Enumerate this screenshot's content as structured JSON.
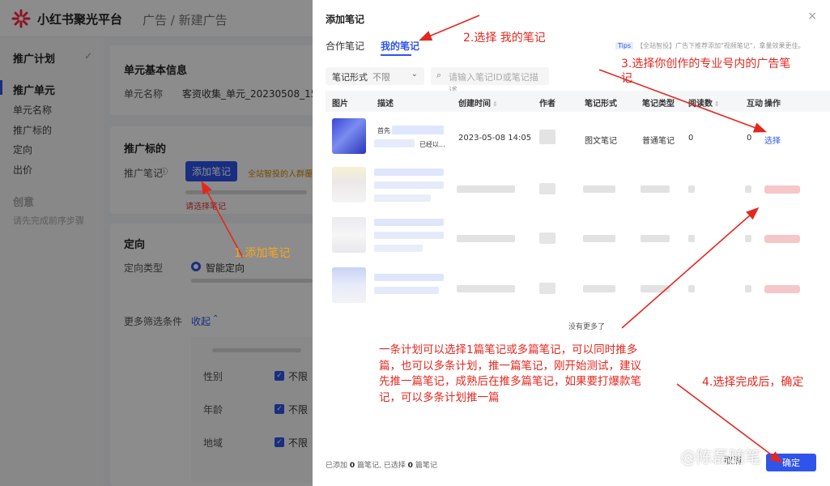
{
  "app": {
    "name": "小红书聚光平台",
    "breadcrumb": "广告 / 新建广告"
  },
  "nav": {
    "plan": "推广计划",
    "unit": "推广单元",
    "items": [
      "单元名称",
      "推广标的",
      "定向",
      "出价"
    ],
    "creative": "创意",
    "creative_hint": "请先完成前序步骤"
  },
  "unit_info": {
    "title": "单元基本信息",
    "name_label": "单元名称",
    "name_value": "客资收集_单元_20230508_155806"
  },
  "target": {
    "title": "推广标的",
    "note_label": "推广笔记",
    "add_button": "添加笔记",
    "hint_orange": "全站智投的人群覆盖",
    "hint_red": "请选择笔记"
  },
  "targeting": {
    "title": "定向",
    "type_label": "定向类型",
    "type_value": "智能定向",
    "more_label": "更多筛选条件",
    "collapse": "收起",
    "gender": "性别",
    "age": "年龄",
    "region": "地域",
    "unlimited": "不限"
  },
  "drawer": {
    "title": "添加笔记",
    "close": "×",
    "tabs": [
      "合作笔记",
      "我的笔记"
    ],
    "active_tab": 1,
    "tips_tag": "Tips",
    "tips_text": "【全站智投】广告下推荐添加\"视频笔记\"，拿量效果更佳。",
    "filter_label": "笔记形式",
    "filter_value": "不限",
    "search_placeholder": "请输入笔记ID或笔记描述",
    "columns": [
      "图片",
      "描述",
      "创建时间",
      "作者",
      "笔记形式",
      "笔记类型",
      "阅读数",
      "互动",
      "操作"
    ],
    "row1": {
      "desc_prefix": "首先",
      "desc_tail": "已经以...",
      "created": "2023-05-08 14:05",
      "form": "图文笔记",
      "type": "普通笔记",
      "reads": "0",
      "interactions": "0",
      "action": "选择"
    },
    "no_more": "没有更多了",
    "footer": {
      "added_prefix": "已添加",
      "added_count": "0",
      "added_suffix": "篇笔记,",
      "selected_prefix": "已选择",
      "selected_count": "0",
      "selected_suffix": "篇笔记"
    },
    "cancel": "取消",
    "ok": "确定"
  },
  "annotations": {
    "step1": "1.添加笔记",
    "step2": "2.选择 我的笔记",
    "step3a": "3.选择你创作的专业号内的广告笔",
    "step3b": "记",
    "step4": "4.选择完成后，确定",
    "note": "一条计划可以选择1篇笔记或多篇笔记，可以同时推多篇，也可以多条计划，推一篇笔记，刚开始测试，建议先推一篇笔记，成熟后在推多篇笔记，如果要打爆款笔记，可以多条计划推一篇",
    "watermark": "@陈磊随笔"
  },
  "colors": {
    "accent": "#2f54eb",
    "annotation": "#e4271e",
    "annotation_orange": "#f5a623"
  },
  "icons": [
    "logo-icon",
    "check-icon",
    "info-icon",
    "close-icon",
    "chevron-down-icon",
    "search-icon",
    "sort-icon"
  ]
}
